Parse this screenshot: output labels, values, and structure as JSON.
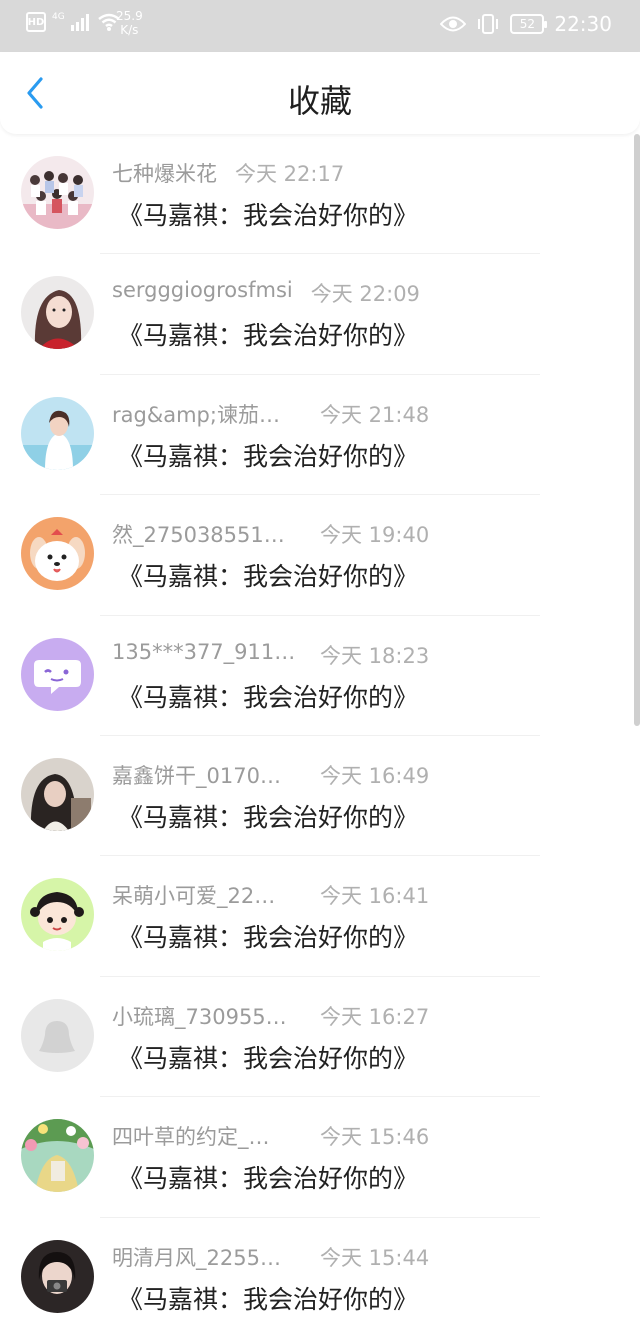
{
  "status_bar": {
    "hd": "HD",
    "signal": "4G",
    "net_speed_value": "25.9",
    "net_speed_unit": "K/s",
    "battery": "52",
    "time": "22:30"
  },
  "header": {
    "title": "收藏"
  },
  "items": [
    {
      "name": "七种爆米花",
      "time": "今天 22:17",
      "title": "《马嘉祺：我会治好你的》",
      "avatar": "group-photo"
    },
    {
      "name": "sergggiogrosfmsi",
      "time": "今天 22:09",
      "title": "《马嘉祺：我会治好你的》",
      "avatar": "girl-red"
    },
    {
      "name": "rag&amp;谏茄…",
      "time": "今天 21:48",
      "title": "《马嘉祺：我会治好你的》",
      "avatar": "girl-beach"
    },
    {
      "name": "然_275038551…",
      "time": "今天 19:40",
      "title": "《马嘉祺：我会治好你的》",
      "avatar": "cartoon-dog"
    },
    {
      "name": "135***377_911…",
      "time": "今天 18:23",
      "title": "《马嘉祺：我会治好你的》",
      "avatar": "chat-bubble"
    },
    {
      "name": "嘉鑫饼干_0170…",
      "time": "今天 16:49",
      "title": "《马嘉祺：我会治好你的》",
      "avatar": "girl-dark"
    },
    {
      "name": "呆萌小可爱_22…",
      "time": "今天 16:41",
      "title": "《马嘉祺：我会治好你的》",
      "avatar": "cartoon-girl"
    },
    {
      "name": "小琉璃_730955…",
      "time": "今天 16:27",
      "title": "《马嘉祺：我会治好你的》",
      "avatar": "default-penguin"
    },
    {
      "name": "四叶草的约定_…",
      "time": "今天 15:46",
      "title": "《马嘉祺：我会治好你的》",
      "avatar": "garden"
    },
    {
      "name": "明清月风_2255…",
      "time": "今天 15:44",
      "title": "《马嘉祺：我会治好你的》",
      "avatar": "girl-camera"
    }
  ],
  "colors": {
    "accent": "#2a9bf0",
    "status_bar_bg": "#d9d9d9",
    "meta_text": "#9b9b9b"
  }
}
